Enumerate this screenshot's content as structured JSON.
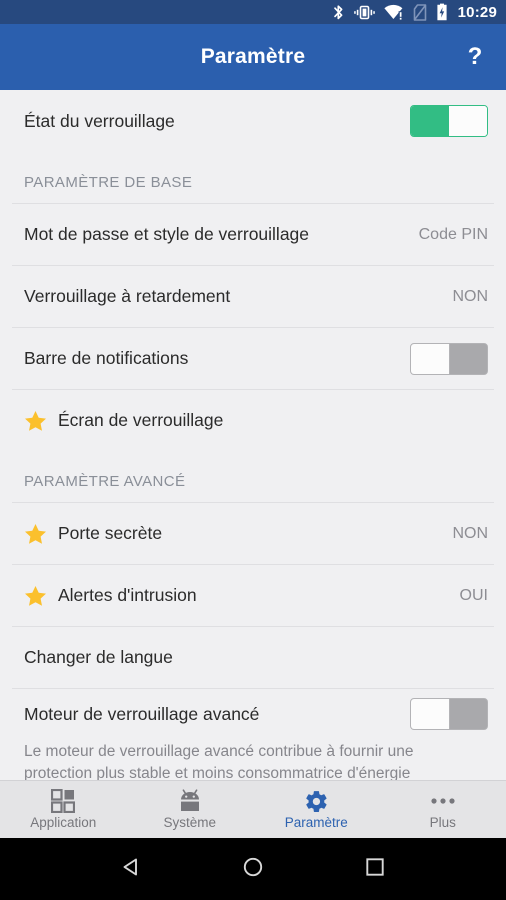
{
  "status_bar": {
    "time": "10:29",
    "icons": [
      "bluetooth-icon",
      "vibrate-icon",
      "wifi-warning-icon",
      "no-sim-icon",
      "battery-charging-icon"
    ],
    "background_color": "#27497f"
  },
  "app_bar": {
    "title": "Paramètre",
    "help_label": "?",
    "background_color": "#2b5fae"
  },
  "content": {
    "master_row": {
      "label": "État du verrouillage",
      "toggle_state": "on"
    },
    "sections": [
      {
        "header": "PARAMÈTRE DE BASE",
        "rows": [
          {
            "label": "Mot de passe et style de verrouillage",
            "value": "Code PIN",
            "starred": false,
            "control": "value"
          },
          {
            "label": "Verrouillage à retardement",
            "value": "NON",
            "starred": false,
            "control": "value"
          },
          {
            "label": "Barre de notifications",
            "value": "",
            "starred": false,
            "control": "toggle",
            "toggle_state": "off"
          },
          {
            "label": "Écran de verrouillage",
            "value": "",
            "starred": true,
            "control": "none"
          }
        ]
      },
      {
        "header": "PARAMÈTRE AVANCÉ",
        "rows": [
          {
            "label": "Porte secrète",
            "value": "NON",
            "starred": true,
            "control": "value"
          },
          {
            "label": "Alertes d'intrusion",
            "value": "OUI",
            "starred": true,
            "control": "value"
          },
          {
            "label": "Changer de langue",
            "value": "",
            "starred": false,
            "control": "none"
          },
          {
            "label": "Moteur de verrouillage avancé",
            "value": "",
            "starred": false,
            "control": "toggle",
            "toggle_state": "off",
            "description": "Le moteur de verrouillage avancé contribue à fournir une protection plus stable et moins consommatrice d'énergie"
          }
        ]
      }
    ],
    "star_color": "#fbc02d",
    "toggle_on_color": "#32bd84",
    "toggle_off_color": "#a9a9ac"
  },
  "tab_bar": {
    "tabs": [
      {
        "label": "Application",
        "icon": "apps-grid-icon",
        "active": false
      },
      {
        "label": "Système",
        "icon": "android-robot-icon",
        "active": false
      },
      {
        "label": "Paramètre",
        "icon": "gear-icon",
        "active": true
      },
      {
        "label": "Plus",
        "icon": "more-dots-icon",
        "active": false
      }
    ],
    "active_color": "#2d62b0",
    "inactive_color": "#77777c"
  },
  "nav_bar": {
    "buttons": [
      "back-triangle-icon",
      "home-circle-icon",
      "recents-square-icon"
    ]
  }
}
